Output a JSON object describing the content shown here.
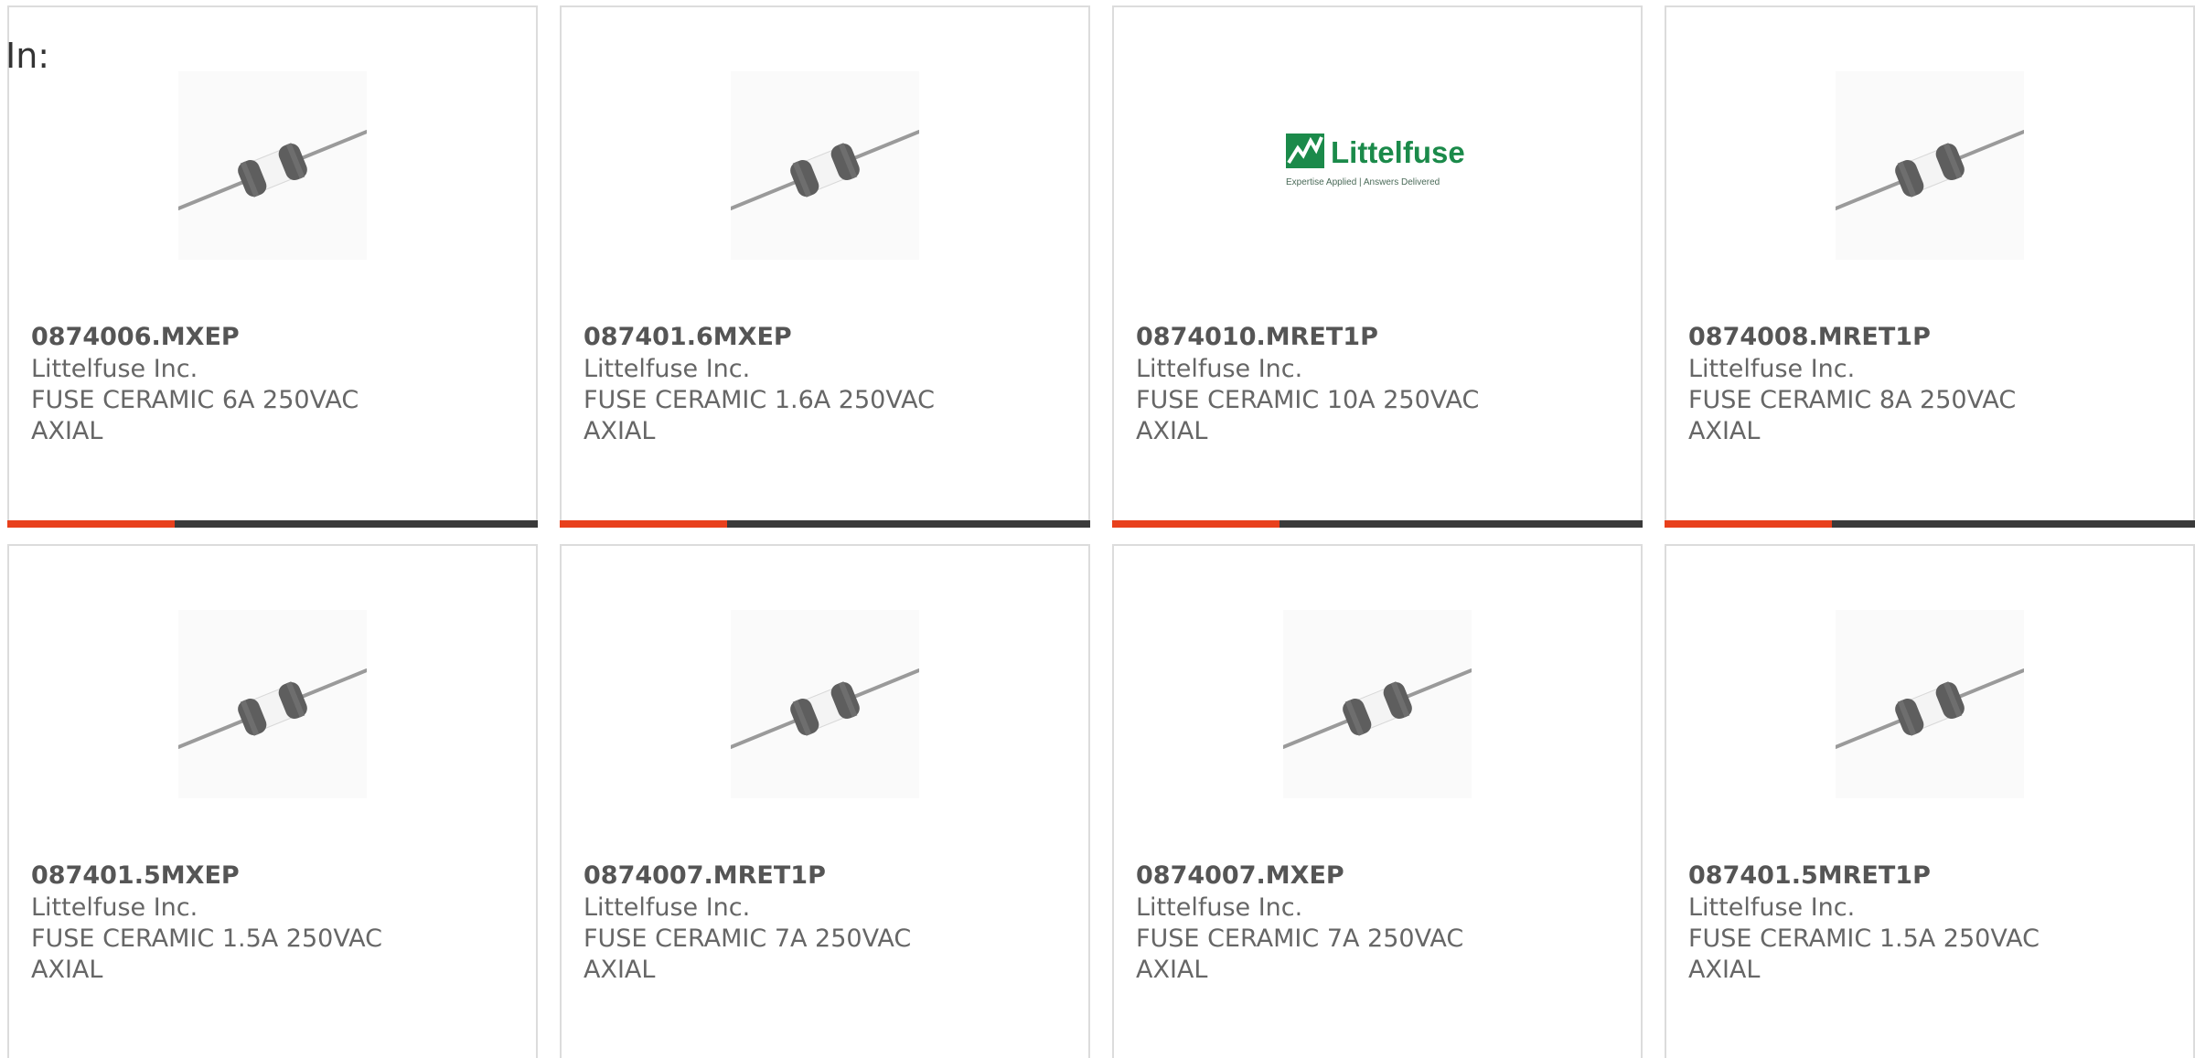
{
  "header": {
    "in_label": "In:"
  },
  "colors": {
    "accent": "#e8401c",
    "bar": "#3a3a3a",
    "logo_green": "#1b8a4a"
  },
  "cards": [
    {
      "part_number": "0874006.MXEP",
      "manufacturer": "Littelfuse Inc.",
      "description": "FUSE CERAMIC 6A 250VAC AXIAL",
      "image": "fuse-icon"
    },
    {
      "part_number": "087401.6MXEP",
      "manufacturer": "Littelfuse Inc.",
      "description": "FUSE CERAMIC 1.6A 250VAC AXIAL",
      "image": "fuse-icon"
    },
    {
      "part_number": "0874010.MRET1P",
      "manufacturer": "Littelfuse Inc.",
      "description": "FUSE CERAMIC 10A 250VAC AXIAL",
      "image": "littelfuse-logo",
      "logo_text": "Littelfuse",
      "logo_tagline": "Expertise Applied | Answers Delivered"
    },
    {
      "part_number": "0874008.MRET1P",
      "manufacturer": "Littelfuse Inc.",
      "description": "FUSE CERAMIC 8A 250VAC AXIAL",
      "image": "fuse-icon"
    },
    {
      "part_number": "087401.5MXEP",
      "manufacturer": "Littelfuse Inc.",
      "description": "FUSE CERAMIC 1.5A 250VAC AXIAL",
      "image": "fuse-icon"
    },
    {
      "part_number": "0874007.MRET1P",
      "manufacturer": "Littelfuse Inc.",
      "description": "FUSE CERAMIC 7A 250VAC AXIAL",
      "image": "fuse-icon"
    },
    {
      "part_number": "0874007.MXEP",
      "manufacturer": "Littelfuse Inc.",
      "description": "FUSE CERAMIC 7A 250VAC AXIAL",
      "image": "fuse-icon"
    },
    {
      "part_number": "087401.5MRET1P",
      "manufacturer": "Littelfuse Inc.",
      "description": "FUSE CERAMIC 1.5A 250VAC AXIAL",
      "image": "fuse-icon"
    }
  ]
}
